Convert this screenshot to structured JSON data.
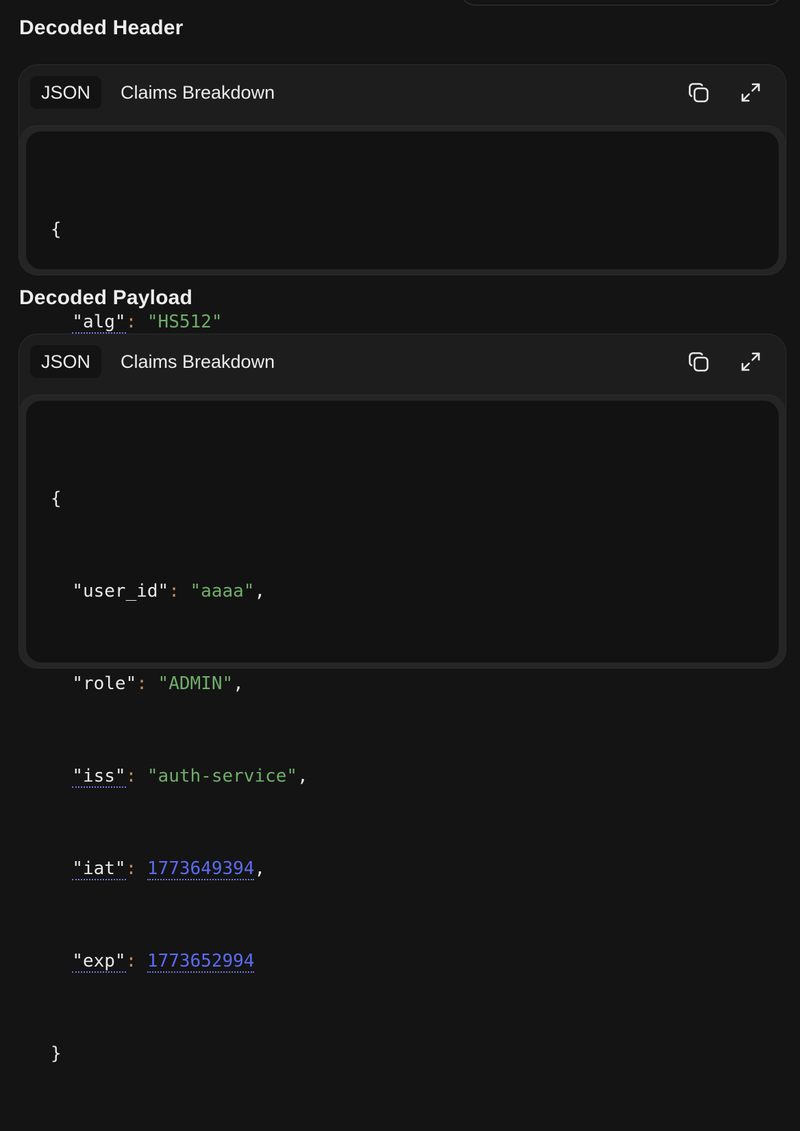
{
  "header_section": {
    "title": "Decoded Header",
    "tabs": {
      "json": "JSON",
      "claims": "Claims Breakdown"
    },
    "copy_icon": "copy-icon",
    "expand_icon": "expand-icon",
    "code": {
      "open": "{",
      "close": "}",
      "lines": [
        {
          "key": "\"alg\"",
          "colon": ":",
          "value": "\"HS512\"",
          "comma": ""
        }
      ]
    }
  },
  "payload_section": {
    "title": "Decoded Payload",
    "tabs": {
      "json": "JSON",
      "claims": "Claims Breakdown"
    },
    "copy_icon": "copy-icon",
    "expand_icon": "expand-icon",
    "code": {
      "open": "{",
      "close": "}",
      "lines": [
        {
          "key": "\"user_id\"",
          "colon": ":",
          "value": "\"aaaa\"",
          "comma": ","
        },
        {
          "key": "\"role\"",
          "colon": ":",
          "value": "\"ADMIN\"",
          "comma": ","
        },
        {
          "key": "\"iss\"",
          "colon": ":",
          "value": "\"auth-service\"",
          "comma": ","
        },
        {
          "key": "\"iat\"",
          "colon": ":",
          "value": "1773649394",
          "comma": ","
        },
        {
          "key": "\"exp\"",
          "colon": ":",
          "value": "1773652994",
          "comma": ""
        }
      ]
    }
  },
  "colors": {
    "background": "#141414",
    "string": "#6fae6a",
    "number": "#5b6cf0",
    "punctuation": "#c48a5a"
  }
}
